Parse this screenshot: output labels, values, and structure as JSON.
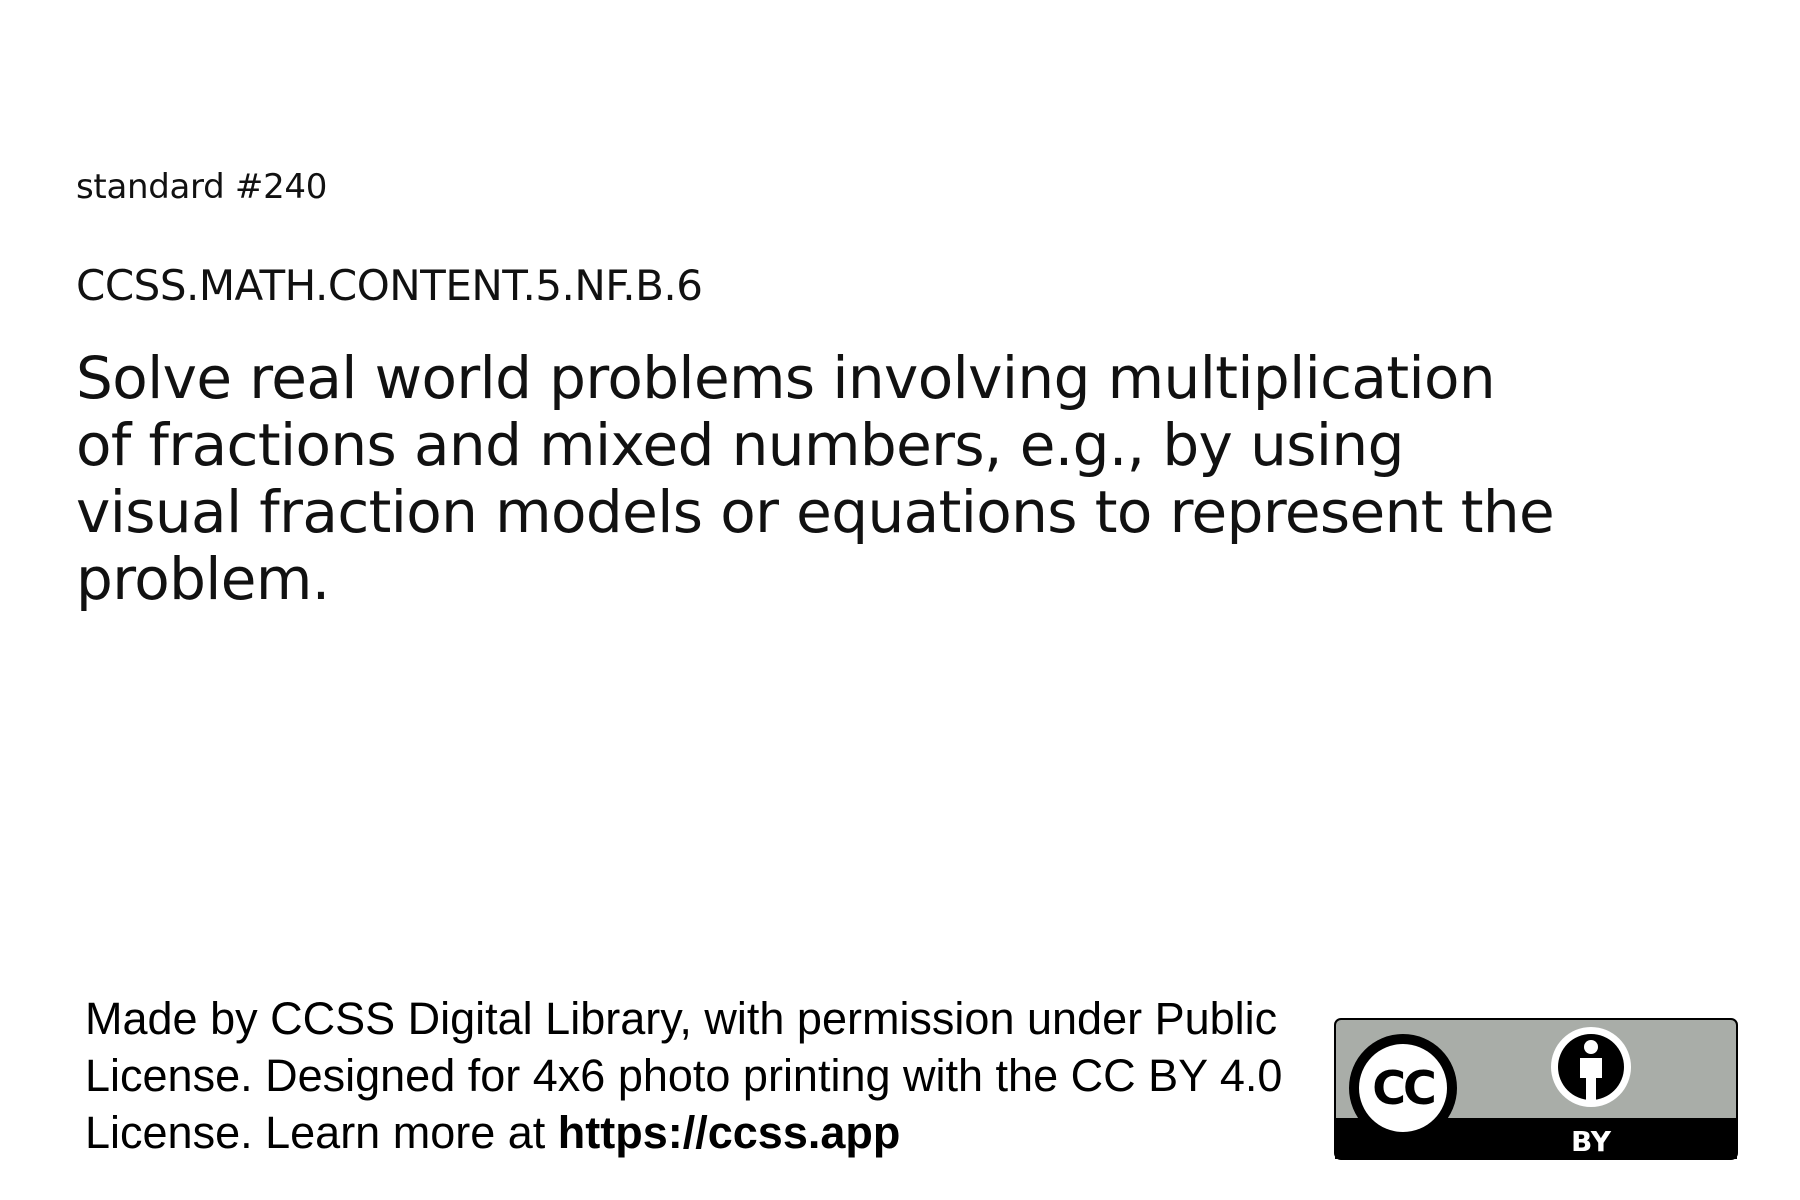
{
  "card": {
    "standard_number": "standard #240",
    "standard_code": "CCSS.MATH.CONTENT.5.NF.B.6",
    "standard_text": "Solve real world problems involving multiplication of fractions and mixed numbers, e.g., by using visual fraction models or equations to represent the problem."
  },
  "footer": {
    "attribution_text": "Made by CCSS Digital Library, with permission under Public License. Designed for 4x6 photo printing with the CC BY 4.0 License. Learn more at",
    "attribution_link": "https://ccss.app"
  },
  "license_badge": {
    "cc_text": "CC",
    "by_text": "BY",
    "badge_colors": {
      "background": "#a9ada8",
      "dark": "#000000",
      "light": "#ffffff"
    }
  }
}
